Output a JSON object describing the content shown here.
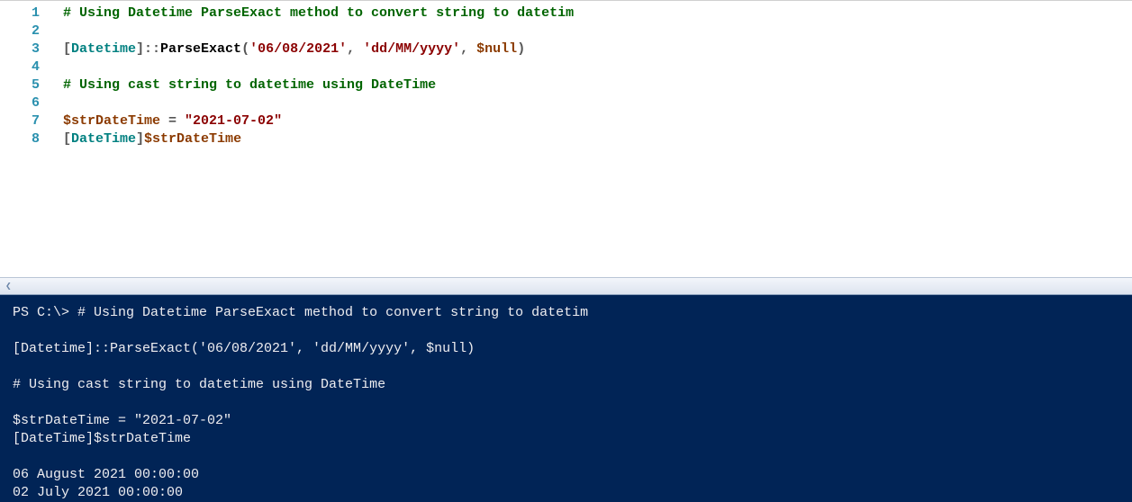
{
  "editor": {
    "gutter": [
      "1",
      "2",
      "3",
      "4",
      "5",
      "6",
      "7",
      "8"
    ],
    "lines": [
      {
        "tokens": [
          {
            "cls": "c-comment",
            "t": "# Using Datetime ParseExact method to convert string to datetim"
          }
        ]
      },
      {
        "tokens": []
      },
      {
        "tokens": [
          {
            "cls": "c-punct",
            "t": "["
          },
          {
            "cls": "c-type",
            "t": "Datetime"
          },
          {
            "cls": "c-punct",
            "t": "]::"
          },
          {
            "cls": "c-method",
            "t": "ParseExact"
          },
          {
            "cls": "c-punct",
            "t": "("
          },
          {
            "cls": "c-string",
            "t": "'06/08/2021'"
          },
          {
            "cls": "c-punct",
            "t": ", "
          },
          {
            "cls": "c-string",
            "t": "'dd/MM/yyyy'"
          },
          {
            "cls": "c-punct",
            "t": ", "
          },
          {
            "cls": "c-var",
            "t": "$null"
          },
          {
            "cls": "c-punct",
            "t": ")"
          }
        ]
      },
      {
        "tokens": []
      },
      {
        "tokens": [
          {
            "cls": "c-comment",
            "t": "# Using cast string to datetime using DateTime"
          }
        ]
      },
      {
        "tokens": []
      },
      {
        "tokens": [
          {
            "cls": "c-var",
            "t": "$strDateTime"
          },
          {
            "cls": "c-punct",
            "t": " = "
          },
          {
            "cls": "c-string",
            "t": "\"2021-07-02\""
          }
        ]
      },
      {
        "tokens": [
          {
            "cls": "c-punct",
            "t": "["
          },
          {
            "cls": "c-type",
            "t": "DateTime"
          },
          {
            "cls": "c-punct",
            "t": "]"
          },
          {
            "cls": "c-var",
            "t": "$strDateTime"
          }
        ]
      }
    ]
  },
  "console": {
    "lines": [
      "PS C:\\> # Using Datetime ParseExact method to convert string to datetim",
      "",
      "[Datetime]::ParseExact('06/08/2021', 'dd/MM/yyyy', $null)",
      "",
      "# Using cast string to datetime using DateTime",
      "",
      "$strDateTime = \"2021-07-02\"",
      "[DateTime]$strDateTime",
      "",
      "06 August 2021 00:00:00",
      "02 July 2021 00:00:00"
    ]
  }
}
